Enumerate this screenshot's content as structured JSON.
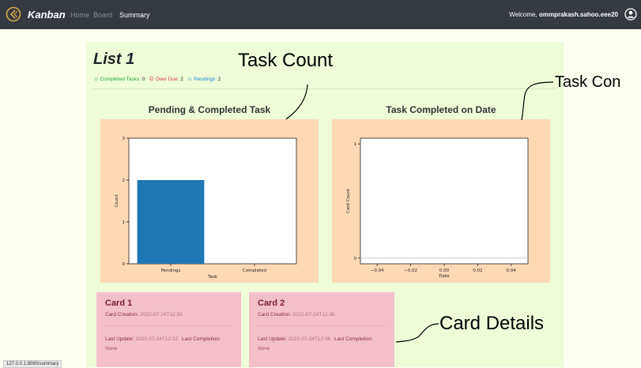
{
  "nav": {
    "brand": "Kanban",
    "links": [
      "Home",
      "Board",
      "Summary"
    ],
    "welcome_prefix": "Welcome,",
    "username": "ommprakash.sahoo.eee20"
  },
  "list": {
    "title": "List 1",
    "stats": {
      "completed_label": "Completed Tasks:",
      "completed_value": "0",
      "overdue_label": "Over Due:",
      "overdue_value": "2",
      "pending_label": "Pendings:",
      "pending_value": "2"
    }
  },
  "annotations": {
    "task_count": "Task Count",
    "task_completed": "Task Con",
    "card_details": "Card Details"
  },
  "chart_data": [
    {
      "type": "bar",
      "title": "Pending & Completed Task",
      "categories": [
        "Pendings",
        "Completed"
      ],
      "values": [
        2,
        0
      ],
      "xlabel": "Task",
      "ylabel": "Count",
      "ylim": [
        0,
        3
      ],
      "yticks": [
        "0",
        "1",
        "2",
        "3"
      ],
      "bar_color": "#1f77b4",
      "grid": false
    },
    {
      "type": "line",
      "title": "Task Completed on Date",
      "x": [],
      "y": [],
      "xlabel": "Date",
      "ylabel": "Card Count",
      "xlim": [
        -0.05,
        0.05
      ],
      "ylim": [
        -0.05,
        1.05
      ],
      "xticks": [
        "−0.04",
        "−0.02",
        "0.00",
        "0.02",
        "0.04"
      ],
      "yticks": [
        "0",
        "1"
      ],
      "grid": false
    }
  ],
  "cards": [
    {
      "title": "Card 1",
      "creation_label": "Card Creation:",
      "creation_value": "2022-07-24T12:32",
      "update_label": "Last Update:",
      "update_value": "2022-07-24T12:32",
      "completion_label": "Last Completion:",
      "completion_value": "None"
    },
    {
      "title": "Card 2",
      "creation_label": "Card Creation:",
      "creation_value": "2022-07-24T12:36",
      "update_label": "Last Update:",
      "update_value": "2022-07-24T12:36",
      "completion_label": "Last Completion:",
      "completion_value": "None"
    }
  ],
  "status_bar": {
    "url": "127.0.0.1:8080/summary"
  }
}
